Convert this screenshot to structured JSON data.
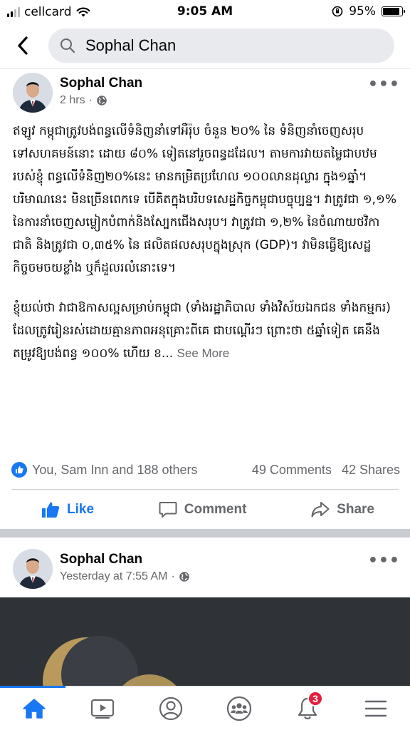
{
  "status_bar": {
    "carrier": "cellcard",
    "time": "9:05 AM",
    "battery": "95%"
  },
  "header": {
    "search_query": "Sophal Chan"
  },
  "posts": [
    {
      "author": "Sophal Chan",
      "time": "2 hrs",
      "paragraphs": [
        "ឥឡូវ កម្ពុជាត្រូវបង់ពន្ធលើទំនិញនាំទៅអឺរ៉ុប ចំនួន ២០% នៃ ទំនិញនាំចេញសរុបទៅសហគមន៍នោះ  ដោយ ៨០% ទៀតនៅរួចពន្ធដដែល។ តាមការវាយតម្លៃជាបឋមរបស់ខ្ញុំ ពន្ធលើទំនិញ២០%នេះ មានកម្រិតប្រហែល ១០០លានដុល្លារ ក្នុង១ឆ្នាំ។ បរិមាណនេះ មិនច្រើនពេកទេ បើគិតក្នុងបរិបទសេដ្ឋកិច្ចកម្ពុជាបច្ចុប្បន្ន។ វាត្រូវជា ១,១% នៃការនាំចេញសម្លៀកបំពាក់និងស្បែកជើងសរុប។ វាត្រូវជា ១,២% នៃចំណាយថវិកាជាតិ និងត្រូវជា ០,៣៥% នៃ ផលិតផលសរុបក្នុងស្រុក (GDP)។ វាមិនធ្វើឱ្យសេដ្ឋកិច្ចចមចយខ្លាំង ឬក៏ដួលរលំនោះទេ។",
        "ខ្ញុំយល់ថា វាជាឱកាសល្អសម្រាប់កម្ពុជា (ទាំងរដ្ឋាភិបាល  ទាំងវិស័យឯកជន ទាំងកម្មករ) ដែលត្រូវរៀនរស់ដោយគ្មានភាពអនុគ្រោះពីគេ ជាបណ្តើរៗ ព្រោះថា ៥ឆ្នាំទៀត គេនឹងតម្រូវឱ្យបង់ពន្ធ ១០០% ហើយ ខ..."
      ],
      "see_more": "See More",
      "reactions": "You, Sam Inn and 188 others",
      "comments": "49 Comments",
      "shares": "42 Shares",
      "actions": {
        "like": "Like",
        "comment": "Comment",
        "share": "Share"
      }
    },
    {
      "author": "Sophal Chan",
      "time": "Yesterday at 7:55 AM"
    }
  ],
  "tabbar": {
    "notification_count": "3",
    "active_tab": "home",
    "icons": [
      "home-icon",
      "watch-icon",
      "profile-icon",
      "groups-icon",
      "bell-icon",
      "menu-icon"
    ]
  },
  "colors": {
    "accent": "#1877f2",
    "badge": "#e41e3f",
    "secondary_text": "#65676b"
  }
}
